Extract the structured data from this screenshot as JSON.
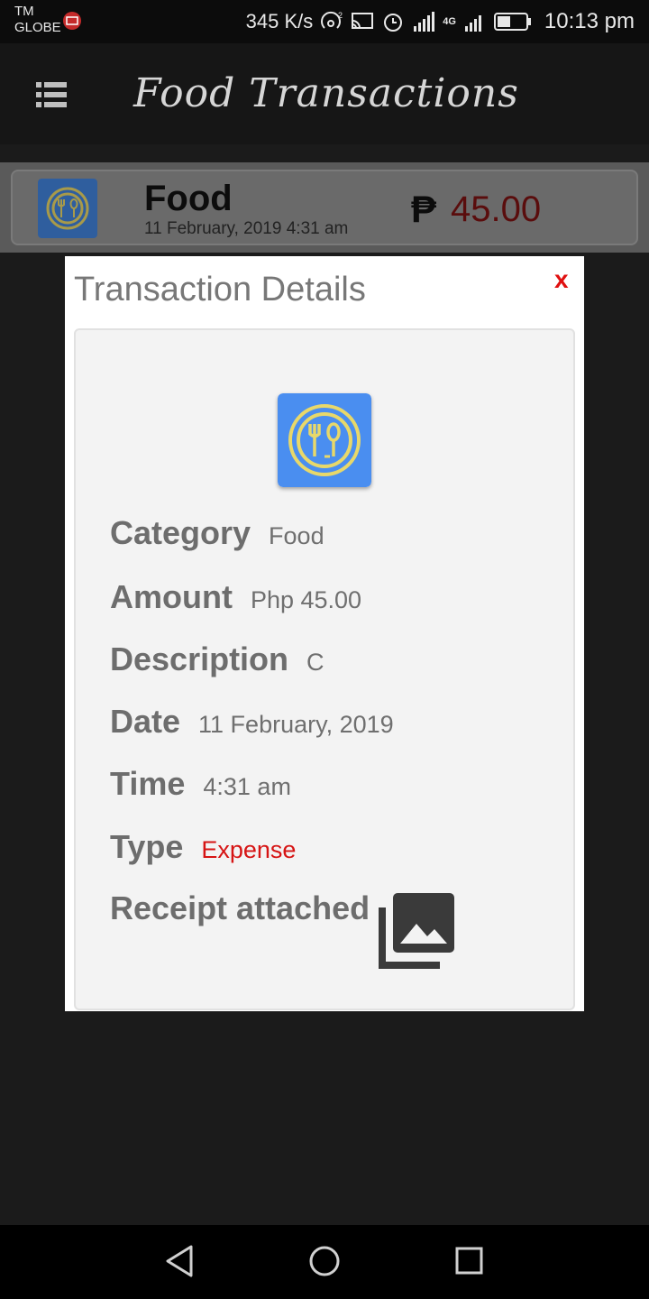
{
  "status_bar": {
    "carrier_line1": "TM",
    "carrier_line2": "GLOBE",
    "net_speed": "345 K/s",
    "network_badge": "4G",
    "time": "10:13 pm",
    "icons": [
      "notification-icon",
      "hotspot-icon",
      "cast-icon",
      "alarm-icon",
      "signal-icon",
      "battery-icon"
    ]
  },
  "app_bar": {
    "title": "Food Transactions",
    "menu_icon": "list-icon"
  },
  "transaction_row": {
    "category": "Food",
    "datetime": "11 February, 2019  4:31 am",
    "currency_symbol": "₱",
    "amount": "45.00",
    "amount_color": "#5a0d0d",
    "icon": "food-plate-icon"
  },
  "dialog": {
    "title": "Transaction Details",
    "close_label": "x",
    "icon": "food-plate-icon",
    "fields": {
      "category": {
        "label": "Category",
        "value": "Food"
      },
      "amount": {
        "label": "Amount",
        "value": "Php 45.00"
      },
      "description": {
        "label": "Description",
        "value": "C"
      },
      "date": {
        "label": "Date",
        "value": "11 February, 2019"
      },
      "time": {
        "label": "Time",
        "value": "4:31 am"
      },
      "type": {
        "label": "Type",
        "value": "Expense"
      },
      "receipt": {
        "label": "Receipt attached",
        "icon": "photo-library-icon"
      }
    }
  },
  "nav_bar": {
    "buttons": [
      "back-icon",
      "home-icon",
      "recents-icon"
    ]
  },
  "colors": {
    "icon_blue": "#4a8ef0",
    "icon_yellow": "#e8d86a",
    "expense_red": "#d61414",
    "close_red": "#e01010"
  }
}
